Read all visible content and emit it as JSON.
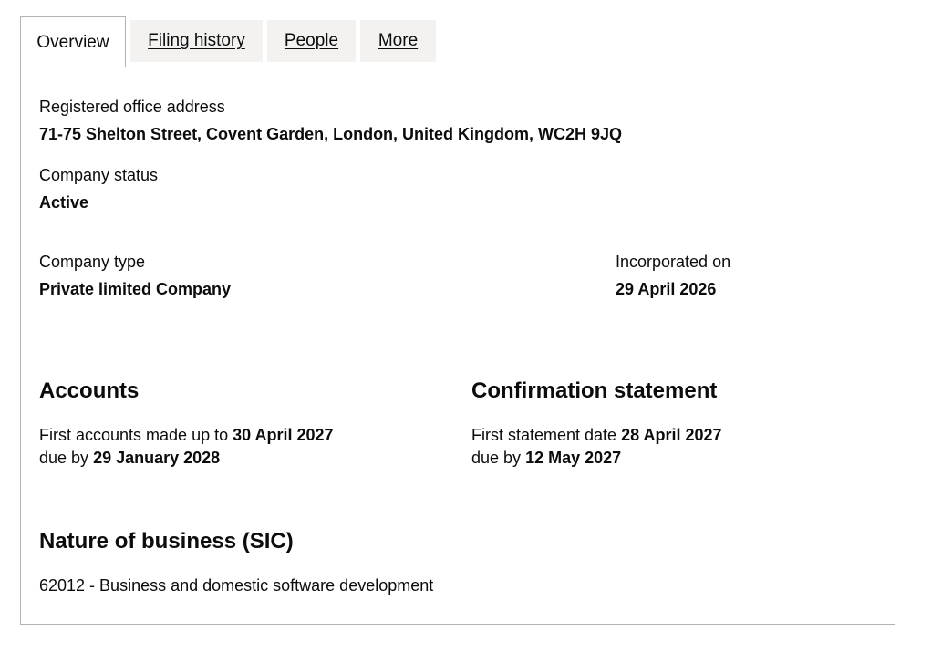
{
  "tabs": [
    {
      "label": "Overview"
    },
    {
      "label": "Filing history"
    },
    {
      "label": "People"
    },
    {
      "label": "More"
    }
  ],
  "overview": {
    "registered_office_label": "Registered office address",
    "registered_office_value": "71-75 Shelton Street, Covent Garden, London, United Kingdom, WC2H 9JQ",
    "status_label": "Company status",
    "status_value": "Active",
    "type_label": "Company type",
    "type_value": "Private limited Company",
    "incorporated_label": "Incorporated on",
    "incorporated_value": "29 April 2026"
  },
  "accounts": {
    "heading": "Accounts",
    "first_accounts_prefix": "First accounts made up to",
    "first_accounts_date": "30 April 2027",
    "due_prefix": "due by",
    "due_date": "29 January 2028"
  },
  "confirmation": {
    "heading": "Confirmation statement",
    "first_statement_prefix": "First statement date",
    "first_statement_date": "28 April 2027",
    "due_prefix": "due by",
    "due_date": "12 May 2027"
  },
  "sic": {
    "heading": "Nature of business (SIC)",
    "entry": "62012 - Business and domestic software development"
  }
}
